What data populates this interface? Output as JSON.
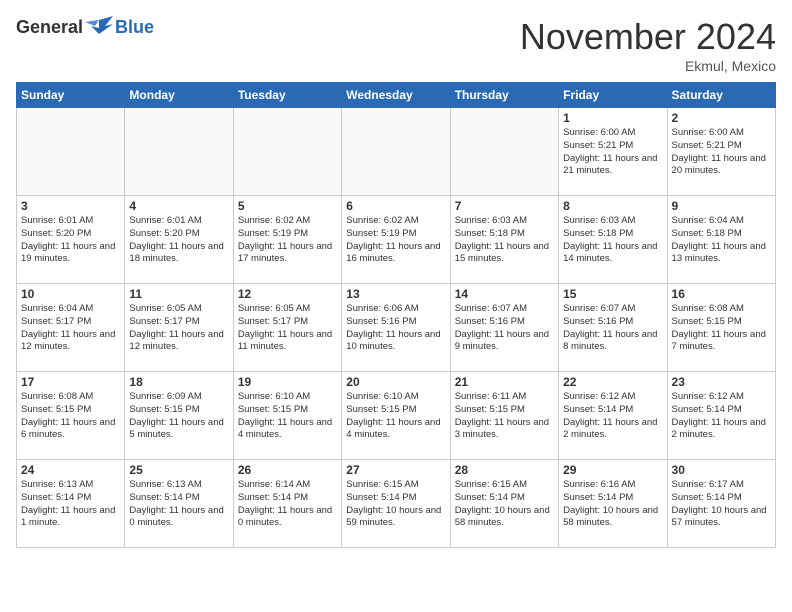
{
  "header": {
    "logo_general": "General",
    "logo_blue": "Blue",
    "month_title": "November 2024",
    "location": "Ekmul, Mexico"
  },
  "calendar": {
    "days_of_week": [
      "Sunday",
      "Monday",
      "Tuesday",
      "Wednesday",
      "Thursday",
      "Friday",
      "Saturday"
    ],
    "weeks": [
      [
        {
          "day": "",
          "info": ""
        },
        {
          "day": "",
          "info": ""
        },
        {
          "day": "",
          "info": ""
        },
        {
          "day": "",
          "info": ""
        },
        {
          "day": "",
          "info": ""
        },
        {
          "day": "1",
          "info": "Sunrise: 6:00 AM\nSunset: 5:21 PM\nDaylight: 11 hours\nand 21 minutes."
        },
        {
          "day": "2",
          "info": "Sunrise: 6:00 AM\nSunset: 5:21 PM\nDaylight: 11 hours\nand 20 minutes."
        }
      ],
      [
        {
          "day": "3",
          "info": "Sunrise: 6:01 AM\nSunset: 5:20 PM\nDaylight: 11 hours\nand 19 minutes."
        },
        {
          "day": "4",
          "info": "Sunrise: 6:01 AM\nSunset: 5:20 PM\nDaylight: 11 hours\nand 18 minutes."
        },
        {
          "day": "5",
          "info": "Sunrise: 6:02 AM\nSunset: 5:19 PM\nDaylight: 11 hours\nand 17 minutes."
        },
        {
          "day": "6",
          "info": "Sunrise: 6:02 AM\nSunset: 5:19 PM\nDaylight: 11 hours\nand 16 minutes."
        },
        {
          "day": "7",
          "info": "Sunrise: 6:03 AM\nSunset: 5:18 PM\nDaylight: 11 hours\nand 15 minutes."
        },
        {
          "day": "8",
          "info": "Sunrise: 6:03 AM\nSunset: 5:18 PM\nDaylight: 11 hours\nand 14 minutes."
        },
        {
          "day": "9",
          "info": "Sunrise: 6:04 AM\nSunset: 5:18 PM\nDaylight: 11 hours\nand 13 minutes."
        }
      ],
      [
        {
          "day": "10",
          "info": "Sunrise: 6:04 AM\nSunset: 5:17 PM\nDaylight: 11 hours\nand 12 minutes."
        },
        {
          "day": "11",
          "info": "Sunrise: 6:05 AM\nSunset: 5:17 PM\nDaylight: 11 hours\nand 12 minutes."
        },
        {
          "day": "12",
          "info": "Sunrise: 6:05 AM\nSunset: 5:17 PM\nDaylight: 11 hours\nand 11 minutes."
        },
        {
          "day": "13",
          "info": "Sunrise: 6:06 AM\nSunset: 5:16 PM\nDaylight: 11 hours\nand 10 minutes."
        },
        {
          "day": "14",
          "info": "Sunrise: 6:07 AM\nSunset: 5:16 PM\nDaylight: 11 hours\nand 9 minutes."
        },
        {
          "day": "15",
          "info": "Sunrise: 6:07 AM\nSunset: 5:16 PM\nDaylight: 11 hours\nand 8 minutes."
        },
        {
          "day": "16",
          "info": "Sunrise: 6:08 AM\nSunset: 5:15 PM\nDaylight: 11 hours\nand 7 minutes."
        }
      ],
      [
        {
          "day": "17",
          "info": "Sunrise: 6:08 AM\nSunset: 5:15 PM\nDaylight: 11 hours\nand 6 minutes."
        },
        {
          "day": "18",
          "info": "Sunrise: 6:09 AM\nSunset: 5:15 PM\nDaylight: 11 hours\nand 5 minutes."
        },
        {
          "day": "19",
          "info": "Sunrise: 6:10 AM\nSunset: 5:15 PM\nDaylight: 11 hours\nand 4 minutes."
        },
        {
          "day": "20",
          "info": "Sunrise: 6:10 AM\nSunset: 5:15 PM\nDaylight: 11 hours\nand 4 minutes."
        },
        {
          "day": "21",
          "info": "Sunrise: 6:11 AM\nSunset: 5:15 PM\nDaylight: 11 hours\nand 3 minutes."
        },
        {
          "day": "22",
          "info": "Sunrise: 6:12 AM\nSunset: 5:14 PM\nDaylight: 11 hours\nand 2 minutes."
        },
        {
          "day": "23",
          "info": "Sunrise: 6:12 AM\nSunset: 5:14 PM\nDaylight: 11 hours\nand 2 minutes."
        }
      ],
      [
        {
          "day": "24",
          "info": "Sunrise: 6:13 AM\nSunset: 5:14 PM\nDaylight: 11 hours\nand 1 minute."
        },
        {
          "day": "25",
          "info": "Sunrise: 6:13 AM\nSunset: 5:14 PM\nDaylight: 11 hours\nand 0 minutes."
        },
        {
          "day": "26",
          "info": "Sunrise: 6:14 AM\nSunset: 5:14 PM\nDaylight: 11 hours\nand 0 minutes."
        },
        {
          "day": "27",
          "info": "Sunrise: 6:15 AM\nSunset: 5:14 PM\nDaylight: 10 hours\nand 59 minutes."
        },
        {
          "day": "28",
          "info": "Sunrise: 6:15 AM\nSunset: 5:14 PM\nDaylight: 10 hours\nand 58 minutes."
        },
        {
          "day": "29",
          "info": "Sunrise: 6:16 AM\nSunset: 5:14 PM\nDaylight: 10 hours\nand 58 minutes."
        },
        {
          "day": "30",
          "info": "Sunrise: 6:17 AM\nSunset: 5:14 PM\nDaylight: 10 hours\nand 57 minutes."
        }
      ]
    ]
  }
}
